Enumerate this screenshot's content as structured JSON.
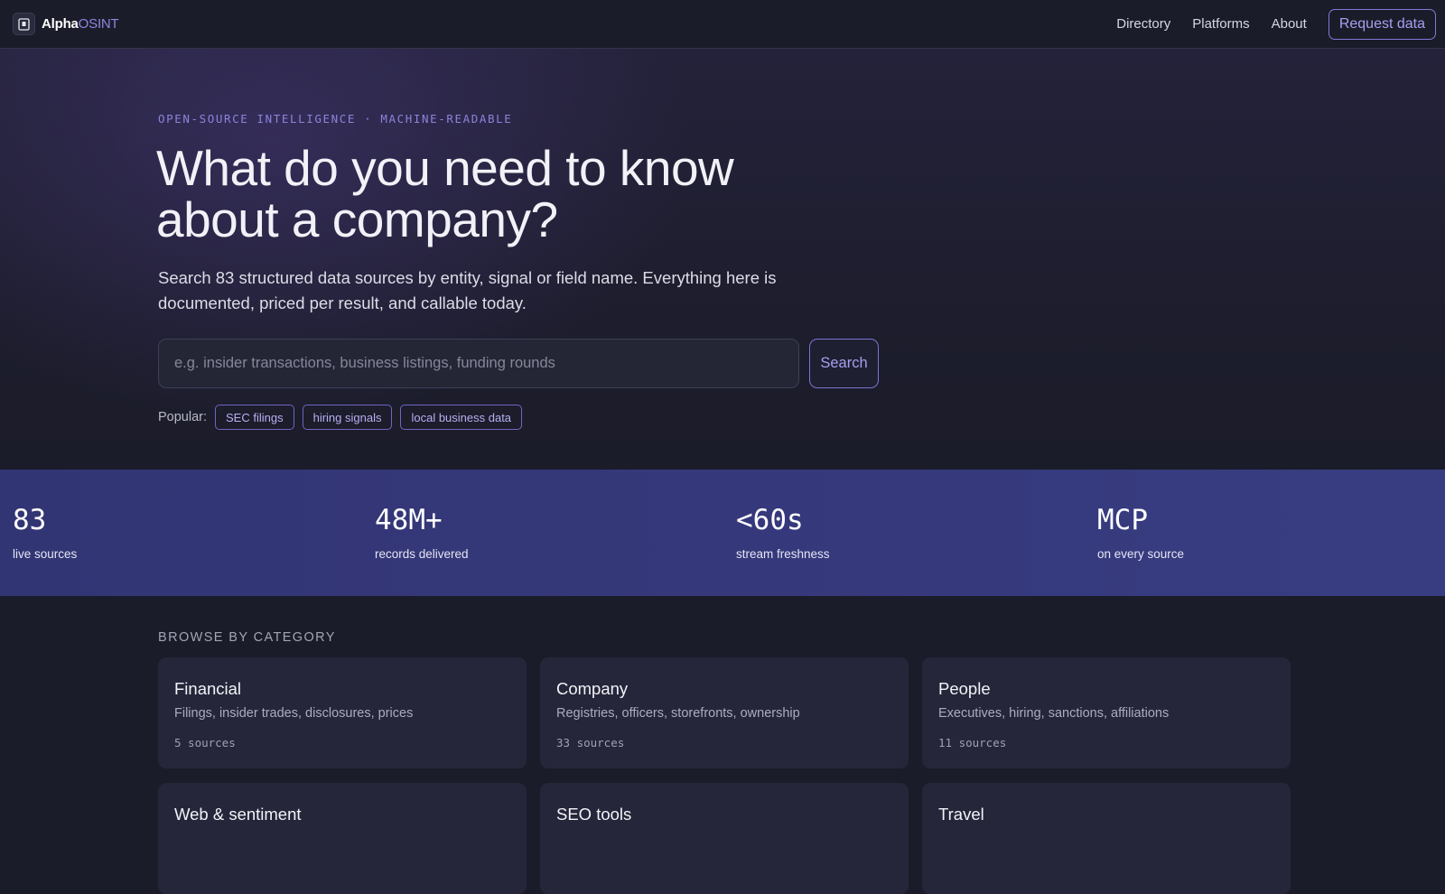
{
  "nav": {
    "brand_primary": "Alpha",
    "brand_accent": "OSINT",
    "links": [
      "Directory",
      "Platforms",
      "About"
    ],
    "cta": "Request data"
  },
  "hero": {
    "eyebrow": "OPEN-SOURCE INTELLIGENCE · MACHINE-READABLE",
    "headline": "What do you need to know about a company?",
    "subtitle": "Search 83 structured data sources by entity, signal or field name. Everything here is documented, priced per result, and callable today.",
    "search_placeholder": "e.g. insider transactions, business listings, funding rounds",
    "search_button": "Search",
    "popular_label": "Popular:",
    "popular_chips": [
      "SEC filings",
      "hiring signals",
      "local business data"
    ]
  },
  "stats": [
    {
      "value": "83",
      "label": "live sources"
    },
    {
      "value": "48M+",
      "label": "records delivered"
    },
    {
      "value": "<60s",
      "label": "stream freshness"
    },
    {
      "value": "MCP",
      "label": "on every source"
    }
  ],
  "categories": {
    "title": "BROWSE BY CATEGORY",
    "items": [
      {
        "name": "Financial",
        "desc": "Filings, insider trades, disclosures, prices",
        "count": "5 sources"
      },
      {
        "name": "Company",
        "desc": "Registries, officers, storefronts, ownership",
        "count": "33 sources"
      },
      {
        "name": "People",
        "desc": "Executives, hiring, sanctions, affiliations",
        "count": "11 sources"
      },
      {
        "name": "Web & sentiment",
        "desc": "",
        "count": ""
      },
      {
        "name": "SEO tools",
        "desc": "",
        "count": ""
      },
      {
        "name": "Travel",
        "desc": "",
        "count": ""
      }
    ]
  },
  "colors": {
    "background": "#1b1c29",
    "accent": "#8f86e3",
    "stats_band": "#34377a",
    "card": "#25263a"
  }
}
